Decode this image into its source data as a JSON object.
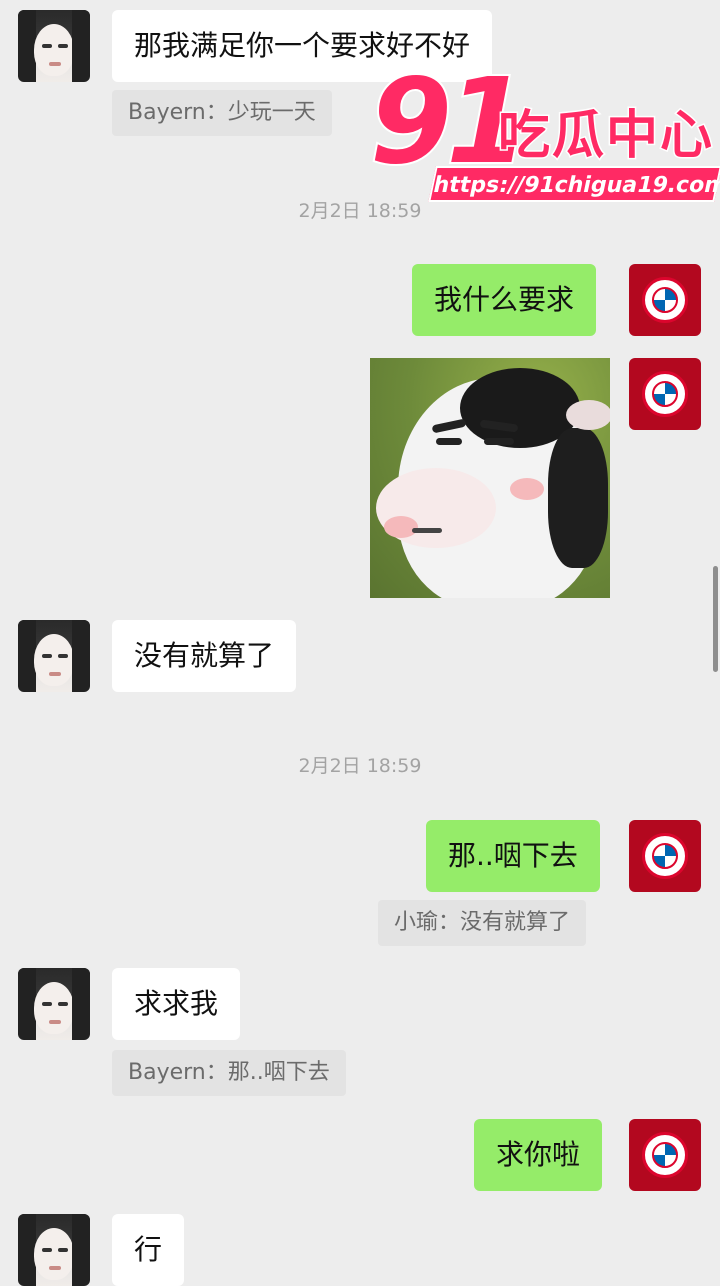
{
  "messages": {
    "m1": {
      "text": "那我满足你一个要求好不好"
    },
    "q1": {
      "text": "Bayern：少玩一天"
    },
    "ts1": {
      "text": "2月2日 18:59"
    },
    "m2": {
      "text": "我什么要求"
    },
    "m3": {
      "text": "没有就算了"
    },
    "ts2": {
      "text": "2月2日 18:59"
    },
    "m4": {
      "text": "那..咽下去"
    },
    "q2": {
      "text": "小瑜：没有就算了"
    },
    "m5": {
      "text": "求求我"
    },
    "q3": {
      "text": "Bayern：那..咽下去"
    },
    "m6": {
      "text": "求你啦"
    },
    "m7": {
      "text": "行"
    }
  },
  "watermark": {
    "number": "91",
    "brand": "吃瓜中心",
    "url": "https://91chigua19.com"
  },
  "colors": {
    "background": "#ededed",
    "incoming_bubble": "#ffffff",
    "outgoing_bubble": "#95ec69",
    "watermark": "#ff2a64"
  }
}
